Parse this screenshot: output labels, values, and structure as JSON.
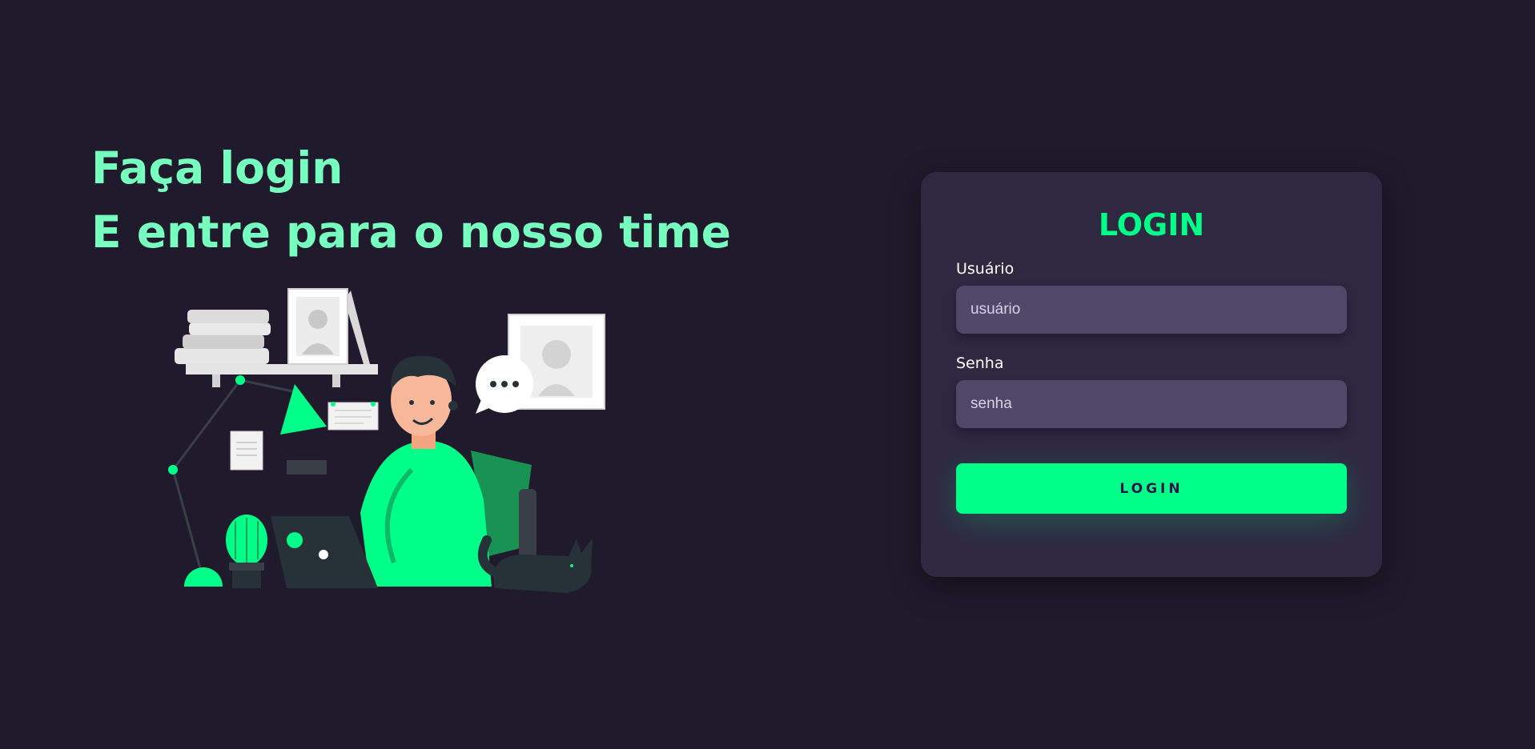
{
  "hero": {
    "line1": "Faça login",
    "line2": "E entre para o nosso time"
  },
  "login_card": {
    "title": "LOGIN",
    "username_label": "Usuário",
    "username_placeholder": "usuário",
    "password_label": "Senha",
    "password_placeholder": "senha",
    "submit_label": "LOGIN"
  },
  "colors": {
    "background": "#201b2c",
    "card": "#2f2841",
    "input": "#514869",
    "accent": "#00ff88",
    "headline": "#77ffc0",
    "button_text": "#2b134b"
  },
  "illustration": {
    "subject": "person-working-on-laptop",
    "icons": [
      "bookshelf-icon",
      "desk-lamp-icon",
      "cactus-icon",
      "laptop-icon",
      "speech-bubble-icon",
      "cat-icon",
      "picture-frame-icon",
      "notes-icon"
    ]
  }
}
